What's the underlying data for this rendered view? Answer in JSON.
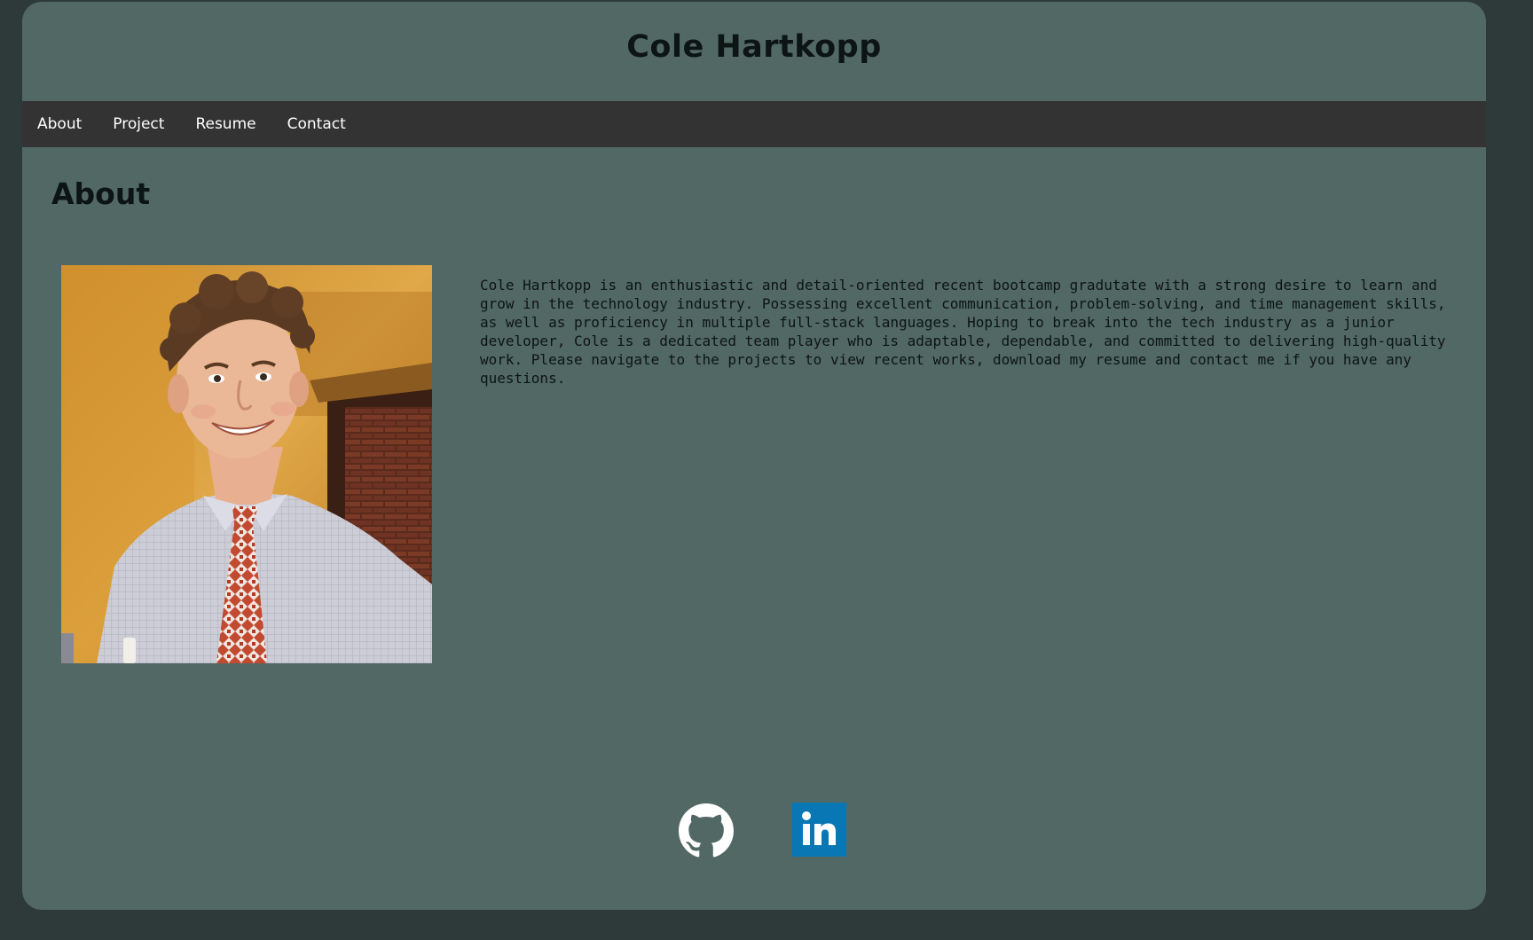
{
  "header": {
    "site_title": "Cole Hartkopp"
  },
  "nav": {
    "items": [
      {
        "label": "About"
      },
      {
        "label": "Project"
      },
      {
        "label": "Resume"
      },
      {
        "label": "Contact"
      }
    ]
  },
  "about": {
    "heading": "About",
    "photo": "portrait-photo",
    "bio": "Cole Hartkopp is an enthusiastic and detail-oriented recent bootcamp gradutate with a strong desire to learn and grow in the technology industry. Possessing excellent communication, problem-solving, and time management skills, as well as proficiency in multiple full-stack languages. Hoping to break into the tech industry as a junior developer, Cole is a dedicated team player who is adaptable, dependable, and committed to delivering high-quality work. Please navigate to the projects to view recent works, download my resume and contact me if you have any questions."
  },
  "footer": {
    "icons": [
      "github-icon",
      "linkedin-icon"
    ]
  },
  "colors": {
    "page_bg": "#2e3a3a",
    "card_bg": "#526865",
    "nav_bg": "#333333",
    "text": "#0c1414",
    "linkedin_blue": "#0a77b5"
  }
}
